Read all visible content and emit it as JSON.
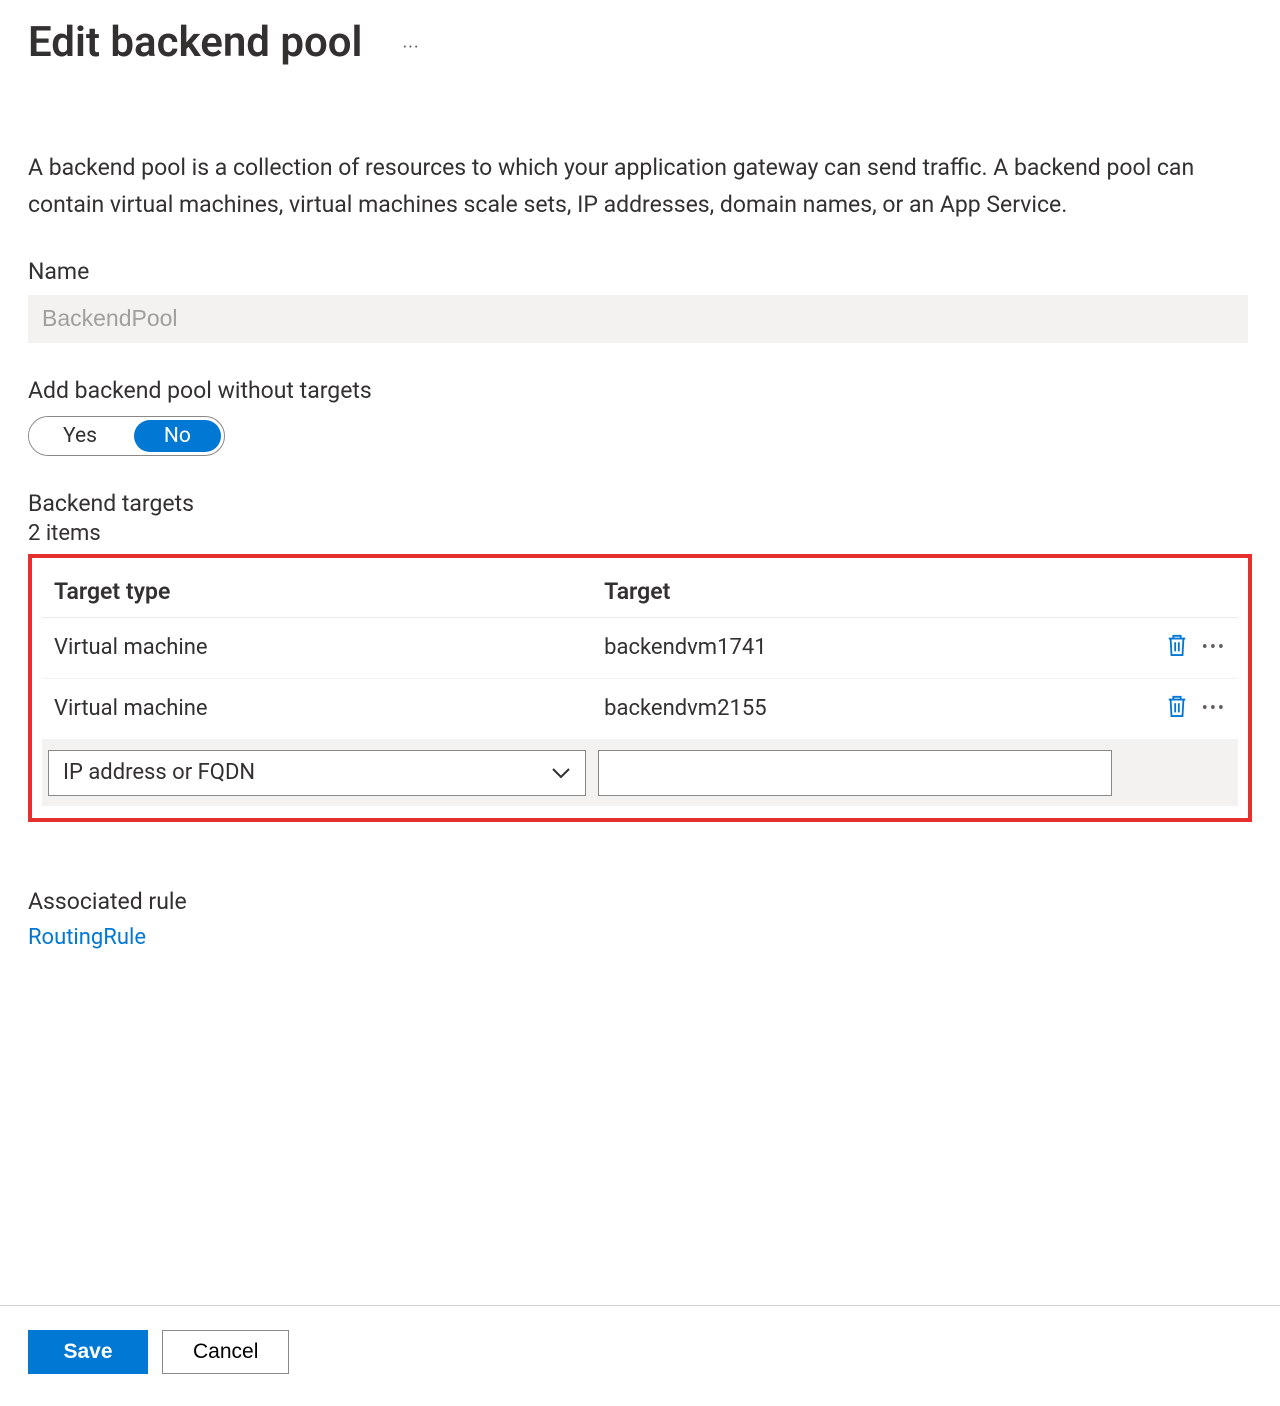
{
  "header": {
    "title": "Edit backend pool"
  },
  "description": "A backend pool is a collection of resources to which your application gateway can send traffic. A backend pool can contain virtual machines, virtual machines scale sets, IP addresses, domain names, or an App Service.",
  "name_field": {
    "label": "Name",
    "value": "BackendPool"
  },
  "without_targets": {
    "label": "Add backend pool without targets",
    "yes": "Yes",
    "no": "No",
    "selected": "No"
  },
  "targets": {
    "section_label": "Backend targets",
    "count_label": "2 items",
    "columns": {
      "type": "Target type",
      "target": "Target"
    },
    "rows": [
      {
        "type": "Virtual machine",
        "target": "backendvm1741"
      },
      {
        "type": "Virtual machine",
        "target": "backendvm2155"
      }
    ],
    "new_row": {
      "type_placeholder": "IP address or FQDN",
      "target_value": ""
    }
  },
  "associated": {
    "label": "Associated rule",
    "link": "RoutingRule"
  },
  "footer": {
    "save": "Save",
    "cancel": "Cancel"
  }
}
